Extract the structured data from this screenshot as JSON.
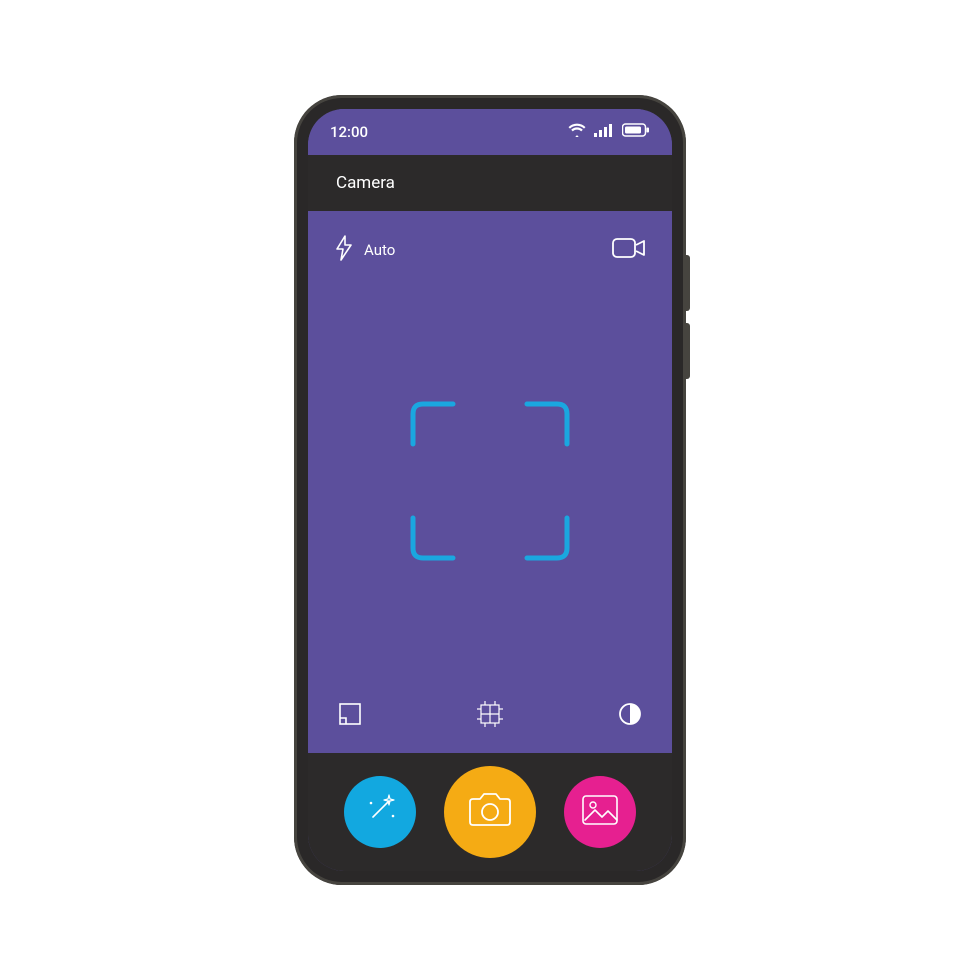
{
  "status": {
    "time": "12:00",
    "icons": {
      "wifi": "wifi-icon",
      "signal": "signal-icon",
      "battery": "battery-icon"
    }
  },
  "header": {
    "title": "Camera"
  },
  "viewfinder": {
    "flash_label": "Auto",
    "top_icons": {
      "flash": "flash-icon",
      "video": "video-icon"
    },
    "focus": "focus-frame",
    "bottom_icons": {
      "crop": "crop-icon",
      "grid": "grid-icon",
      "contrast": "contrast-icon"
    }
  },
  "actions": {
    "effects": "magic-wand-icon",
    "shutter": "camera-icon",
    "gallery": "gallery-icon"
  },
  "colors": {
    "purple": "#5c4f9c",
    "dark": "#2c2a2a",
    "cyan": "#12a8e0",
    "yellow": "#f5ab14",
    "pink": "#e62090",
    "focus": "#1aa7e0"
  }
}
